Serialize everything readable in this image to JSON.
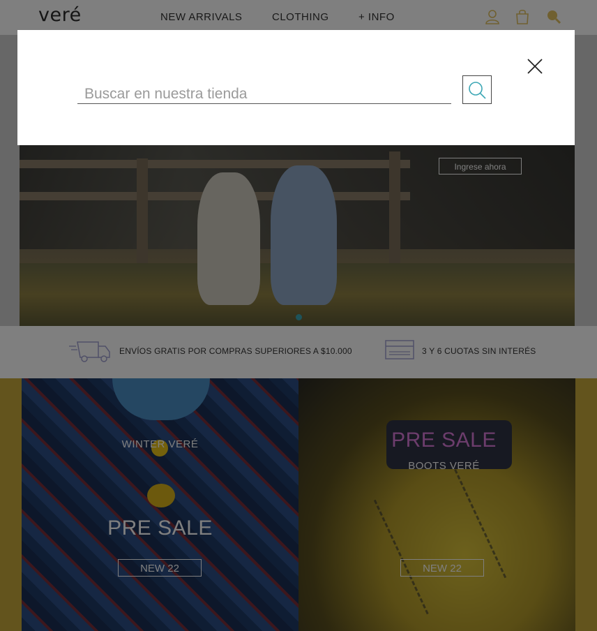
{
  "header": {
    "logo": "veré",
    "nav": [
      "NEW ARRIVALS",
      "CLOTHING",
      "+ INFO"
    ],
    "icons": [
      "user-icon",
      "shopping-bag-icon",
      "search-icon"
    ]
  },
  "hero": {
    "cta_label": "Ingrese ahora",
    "slider_dots": 1
  },
  "benefits": {
    "shipping": "ENVÍOS GRATIS POR COMPRAS SUPERIORES A $10.000",
    "installments": "3 Y 6 CUOTAS SIN INTERÉS",
    "icons": [
      "truck-icon",
      "credit-card-icon"
    ]
  },
  "promo": {
    "left": {
      "subtitle": "WINTER VERÉ",
      "title": "PRE SALE",
      "button": "NEW 22"
    },
    "right": {
      "title": "PRE SALE",
      "subtitle": "BOOTS VERÉ",
      "button": "NEW 22"
    }
  },
  "search_modal": {
    "placeholder": "Buscar en nuestra tienda",
    "value": "",
    "icons": [
      "search-icon",
      "close-icon"
    ]
  },
  "colors": {
    "accent": "#3ca7b5",
    "promo_background": "#c7a83a",
    "overlay": "rgba(0,0,0,0.5)"
  }
}
